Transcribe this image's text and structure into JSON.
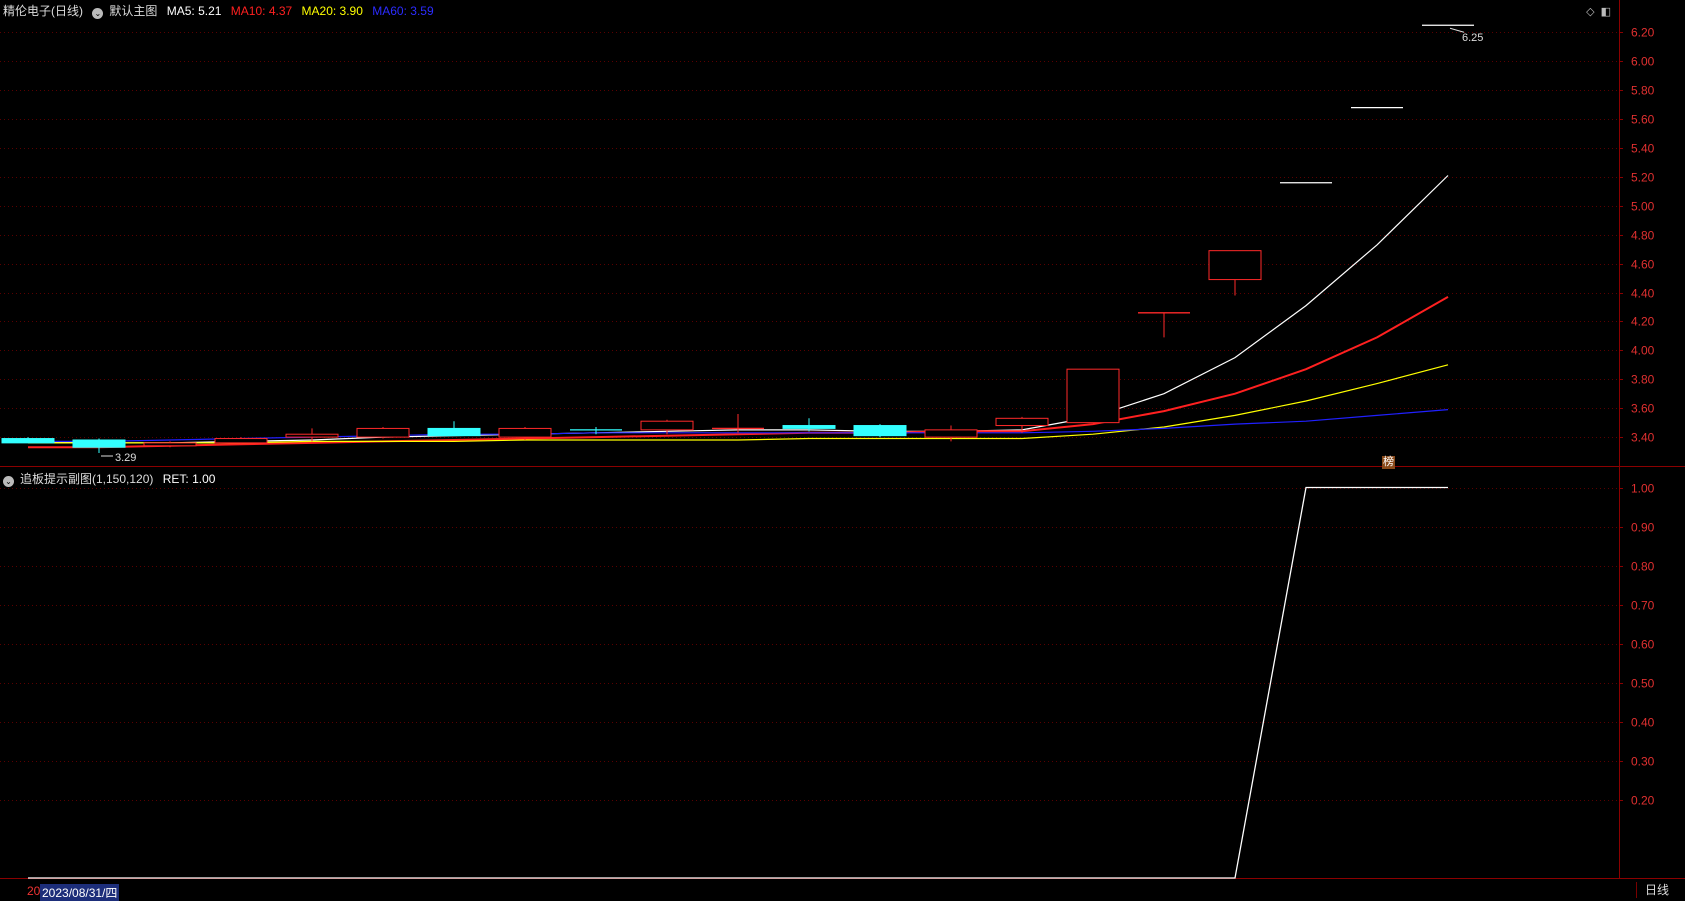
{
  "header": {
    "stock_name": "精伦电子",
    "period_label": "(日线)",
    "indicator_name": "默认主图",
    "ma": [
      {
        "label": "MA5:",
        "value": "5.21",
        "color": "#ffffff"
      },
      {
        "label": "MA10:",
        "value": "4.37",
        "color": "#ff2020"
      },
      {
        "label": "MA20:",
        "value": "3.90",
        "color": "#ffff00"
      },
      {
        "label": "MA60:",
        "value": "3.59",
        "color": "#2020ff"
      }
    ]
  },
  "sub_header": {
    "indicator_name": "追板提示副图(1,150,120)",
    "ret_label": "RET:",
    "ret_value": "1.00"
  },
  "top_icons": [
    "diamond-icon",
    "window-icon"
  ],
  "markers": {
    "high": "6.25",
    "low": "3.29",
    "bang": "榜"
  },
  "status": {
    "date_prefix": "20",
    "date": "2023/08/31/四",
    "period_tab": "日线"
  },
  "colors": {
    "up": "#ff2a2a",
    "down": "#33ffff",
    "axis": "#8b0000",
    "grid": "#5a0000"
  },
  "chart_data": [
    {
      "type": "candlestick",
      "title": "精伦电子(日线)",
      "ylim": [
        3.2,
        6.3
      ],
      "yticks": [
        "3.40",
        "3.60",
        "3.80",
        "4.00",
        "4.20",
        "4.40",
        "4.60",
        "4.80",
        "5.00",
        "5.20",
        "5.40",
        "5.60",
        "5.80",
        "6.00",
        "6.20"
      ],
      "candles": [
        {
          "o": 3.39,
          "h": 3.4,
          "l": 3.36,
          "c": 3.36
        },
        {
          "o": 3.38,
          "h": 3.39,
          "l": 3.29,
          "c": 3.33
        },
        {
          "o": 3.34,
          "h": 3.37,
          "l": 3.33,
          "c": 3.36
        },
        {
          "o": 3.36,
          "h": 3.4,
          "l": 3.35,
          "c": 3.39
        },
        {
          "o": 3.4,
          "h": 3.46,
          "l": 3.37,
          "c": 3.42
        },
        {
          "o": 3.4,
          "h": 3.47,
          "l": 3.39,
          "c": 3.46
        },
        {
          "o": 3.46,
          "h": 3.51,
          "l": 3.42,
          "c": 3.41
        },
        {
          "o": 3.4,
          "h": 3.47,
          "l": 3.38,
          "c": 3.46
        },
        {
          "o": 3.45,
          "h": 3.47,
          "l": 3.42,
          "c": 3.44
        },
        {
          "o": 3.45,
          "h": 3.52,
          "l": 3.42,
          "c": 3.51
        },
        {
          "o": 3.46,
          "h": 3.56,
          "l": 3.43,
          "c": 3.46
        },
        {
          "o": 3.48,
          "h": 3.53,
          "l": 3.44,
          "c": 3.46
        },
        {
          "o": 3.48,
          "h": 3.49,
          "l": 3.4,
          "c": 3.41
        },
        {
          "o": 3.4,
          "h": 3.48,
          "l": 3.37,
          "c": 3.45
        },
        {
          "o": 3.48,
          "h": 3.54,
          "l": 3.43,
          "c": 3.53
        },
        {
          "o": 3.5,
          "h": 3.87,
          "l": 3.5,
          "c": 3.87
        },
        {
          "o": 4.26,
          "h": 4.26,
          "l": 4.09,
          "c": 4.26
        },
        {
          "o": 4.49,
          "h": 4.69,
          "l": 4.38,
          "c": 4.69
        },
        {
          "o": 5.16,
          "h": 5.16,
          "l": 5.16,
          "c": 5.16
        },
        {
          "o": 5.68,
          "h": 5.68,
          "l": 5.68,
          "c": 5.68
        },
        {
          "o": 6.25,
          "h": 6.25,
          "l": 6.25,
          "c": 6.25
        }
      ],
      "series": [
        {
          "name": "MA5",
          "color": "#ffffff",
          "values": [
            3.37,
            3.36,
            3.36,
            3.37,
            3.38,
            3.4,
            3.41,
            3.42,
            3.43,
            3.44,
            3.45,
            3.45,
            3.44,
            3.44,
            3.45,
            3.54,
            3.7,
            3.95,
            4.31,
            4.73,
            5.21
          ]
        },
        {
          "name": "MA10",
          "color": "#ff2020",
          "values": [
            3.33,
            3.33,
            3.34,
            3.35,
            3.36,
            3.37,
            3.38,
            3.39,
            3.4,
            3.41,
            3.42,
            3.43,
            3.43,
            3.44,
            3.44,
            3.49,
            3.58,
            3.7,
            3.87,
            4.09,
            4.37
          ]
        },
        {
          "name": "MA20",
          "color": "#ffff00",
          "values": [
            3.36,
            3.36,
            3.36,
            3.36,
            3.37,
            3.37,
            3.37,
            3.38,
            3.38,
            3.38,
            3.38,
            3.39,
            3.39,
            3.39,
            3.39,
            3.42,
            3.47,
            3.55,
            3.65,
            3.77,
            3.9
          ]
        },
        {
          "name": "MA60",
          "color": "#2020ff",
          "values": [
            3.37,
            3.37,
            3.38,
            3.39,
            3.4,
            3.41,
            3.42,
            3.42,
            3.43,
            3.43,
            3.43,
            3.43,
            3.43,
            3.43,
            3.43,
            3.44,
            3.46,
            3.49,
            3.51,
            3.55,
            3.59
          ]
        }
      ]
    },
    {
      "type": "line",
      "title": "追板提示副图(1,150,120)",
      "ylim": [
        0.0,
        1.05
      ],
      "yticks": [
        "0.20",
        "0.30",
        "0.40",
        "0.50",
        "0.60",
        "0.70",
        "0.80",
        "0.90",
        "1.00"
      ],
      "series": [
        {
          "name": "RET",
          "color": "#ffffff",
          "values": [
            0,
            0,
            0,
            0,
            0,
            0,
            0,
            0,
            0,
            0,
            0,
            0,
            0,
            0,
            0,
            0,
            0,
            0,
            1,
            1,
            1
          ]
        }
      ]
    }
  ]
}
